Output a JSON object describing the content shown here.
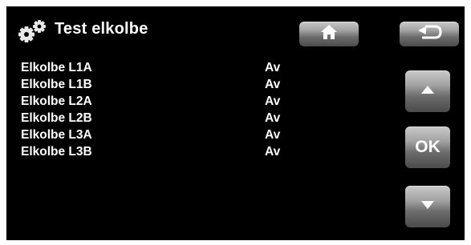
{
  "header": {
    "title": "Test elkolbe",
    "icon": "gears-icon"
  },
  "nav": {
    "home_icon": "home-icon",
    "back_icon": "back-arrow-icon",
    "up_icon": "arrow-up-icon",
    "ok_label": "OK",
    "down_icon": "arrow-down-icon"
  },
  "items": [
    {
      "label": "Elkolbe L1A",
      "value": "Av"
    },
    {
      "label": "Elkolbe L1B",
      "value": "Av"
    },
    {
      "label": "Elkolbe L2A",
      "value": "Av"
    },
    {
      "label": "Elkolbe L2B",
      "value": "Av"
    },
    {
      "label": "Elkolbe L3A",
      "value": "Av"
    },
    {
      "label": "Elkolbe L3B",
      "value": "Av"
    }
  ],
  "colors": {
    "background": "#000000",
    "text": "#ffffff",
    "button": "#8a8a8a"
  }
}
